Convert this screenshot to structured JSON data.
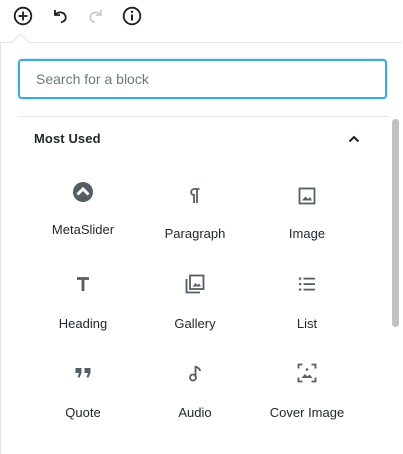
{
  "toolbar": {
    "add_icon": "plus-circle-icon",
    "undo_icon": "undo-icon",
    "redo_icon": "redo-icon",
    "info_icon": "info-icon"
  },
  "inserter": {
    "search": {
      "placeholder": "Search for a block",
      "value": ""
    },
    "panel": {
      "title": "Most Used",
      "expanded": true
    },
    "blocks": [
      {
        "label": "MetaSlider",
        "icon": "metaslider-icon"
      },
      {
        "label": "Paragraph",
        "icon": "paragraph-icon"
      },
      {
        "label": "Image",
        "icon": "image-icon"
      },
      {
        "label": "Heading",
        "icon": "heading-icon"
      },
      {
        "label": "Gallery",
        "icon": "gallery-icon"
      },
      {
        "label": "List",
        "icon": "list-icon"
      },
      {
        "label": "Quote",
        "icon": "quote-icon"
      },
      {
        "label": "Audio",
        "icon": "audio-icon"
      },
      {
        "label": "Cover Image",
        "icon": "cover-image-icon"
      }
    ]
  },
  "colors": {
    "focus_border": "#3fa9d6",
    "icon": "#555d66",
    "text": "#23282d"
  }
}
